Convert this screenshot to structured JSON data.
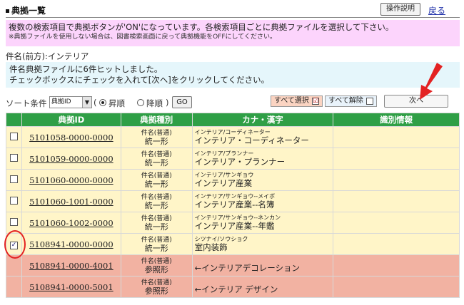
{
  "header": {
    "title": "典拠一覧",
    "help_label": "操作説明",
    "back_label": "戻る"
  },
  "notice": {
    "line1": "複数の検索項目で典拠ボタンが'ON'になっています。各検索項目ごとに典拠ファイルを選択して下さい。",
    "line2": "※典拠ファイルを使用しない場合は、図書検索画面に戻って典拠機能をOFFにしてください。"
  },
  "subject_label": "件名(前方):インテリア",
  "message": {
    "line1": "件名典拠ファイルに6件ヒットしました。",
    "line2": "チェックボックスにチェックを入れて[次へ]をクリックしてください。"
  },
  "sort": {
    "label": "ソート条件",
    "selected": "典拠ID",
    "asc_label": "昇順",
    "desc_label": "降順",
    "open_paren": "(",
    "close_paren": ")",
    "go_label": "GO"
  },
  "buttons": {
    "select_all": "すべて選択",
    "select_all_mark": "☑",
    "deselect_all": "すべて解除",
    "next": "次へ"
  },
  "table": {
    "headers": [
      "典拠ID",
      "典拠種別",
      "カナ・漢字",
      "識別情報"
    ],
    "rows": [
      {
        "id": "5101058-0000-0000",
        "type1": "件名(普通)",
        "type2": "統一形",
        "kana": "インテリア/コーディネーター",
        "kanji": "インテリア・コーディネーター",
        "checked": "",
        "style": "y"
      },
      {
        "id": "5101059-0000-0000",
        "type1": "件名(普通)",
        "type2": "統一形",
        "kana": "インテリア/プランナー",
        "kanji": "インテリア・プランナー",
        "checked": "",
        "style": "y"
      },
      {
        "id": "5101060-0000-0000",
        "type1": "件名(普通)",
        "type2": "統一形",
        "kana": "インテリア/サンギョウ",
        "kanji": "インテリア産業",
        "checked": "",
        "style": "y"
      },
      {
        "id": "5101060-1001-0000",
        "type1": "件名(普通)",
        "type2": "統一形",
        "kana": "インテリア/サンギョウ--メイボ",
        "kanji": "インテリア産業--名簿",
        "checked": "",
        "style": "y"
      },
      {
        "id": "5101060-1002-0000",
        "type1": "件名(普通)",
        "type2": "統一形",
        "kana": "インテリア/サンギョウ--ネンカン",
        "kanji": "インテリア産業--年鑑",
        "checked": "",
        "style": "y"
      },
      {
        "id": "5108941-0000-0000",
        "type1": "件名(普通)",
        "type2": "統一形",
        "kana": "シツナイ/ソウショク",
        "kanji": "室内装飾",
        "checked": "✓",
        "style": "y"
      },
      {
        "id": "5108941-0000-4001",
        "type1": "件名(普通)",
        "type2": "参照形",
        "ref": "←インテリアデコレーション",
        "style": "s"
      },
      {
        "id": "5108941-0000-5001",
        "type1": "件名(普通)",
        "type2": "参照形",
        "ref": "←インテリア デザイン",
        "style": "s"
      }
    ]
  },
  "colors": {
    "header_green": "#2f9f46",
    "row_yellow": "#fff5c8",
    "row_salmon": "#f2b2a2",
    "notice_pink": "#fcd4fc",
    "message_blue": "#e5f6fb",
    "annotation_red": "#e32222"
  }
}
